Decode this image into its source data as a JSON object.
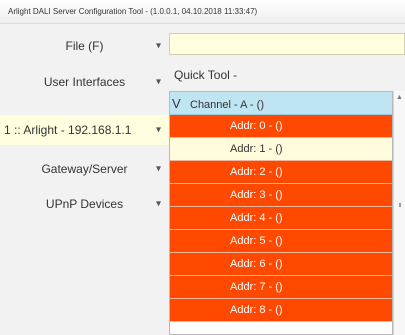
{
  "window": {
    "title": "Arlight DALI Server Configuration Tool - (1.0.0.1, 04.10.2018 11:33:47)"
  },
  "menu": {
    "items": [
      {
        "label": "File (F)",
        "arrow": "▾"
      },
      {
        "label": "User Interfaces",
        "arrow": "▾"
      },
      {
        "label": "1 :: Arlight - 192.168.1.1",
        "arrow": "▾"
      },
      {
        "label": "Gateway/Server",
        "arrow": "▾"
      },
      {
        "label": "UPnP Devices",
        "arrow": "▾"
      }
    ]
  },
  "file_field": {
    "value": ""
  },
  "quick_tool": {
    "label": "Quick Tool -"
  },
  "tree": {
    "channel": {
      "chevron": "V",
      "label": "Channel - A - ()"
    },
    "addresses": [
      "Addr: 0 - ()",
      "Addr: 1 - ()",
      "Addr: 2 - ()",
      "Addr: 3 - ()",
      "Addr: 4 - ()",
      "Addr: 5 - ()",
      "Addr: 6 - ()",
      "Addr: 7 - ()",
      "Addr: 8 - ()"
    ],
    "selected_index": 1
  },
  "scrollbar": {
    "up_arrow": "▲"
  },
  "colors": {
    "address_row": "#ff4800",
    "selected_row": "#fffbdd",
    "channel_row": "#bfe4f2",
    "highlight_field": "#ffffe0"
  }
}
